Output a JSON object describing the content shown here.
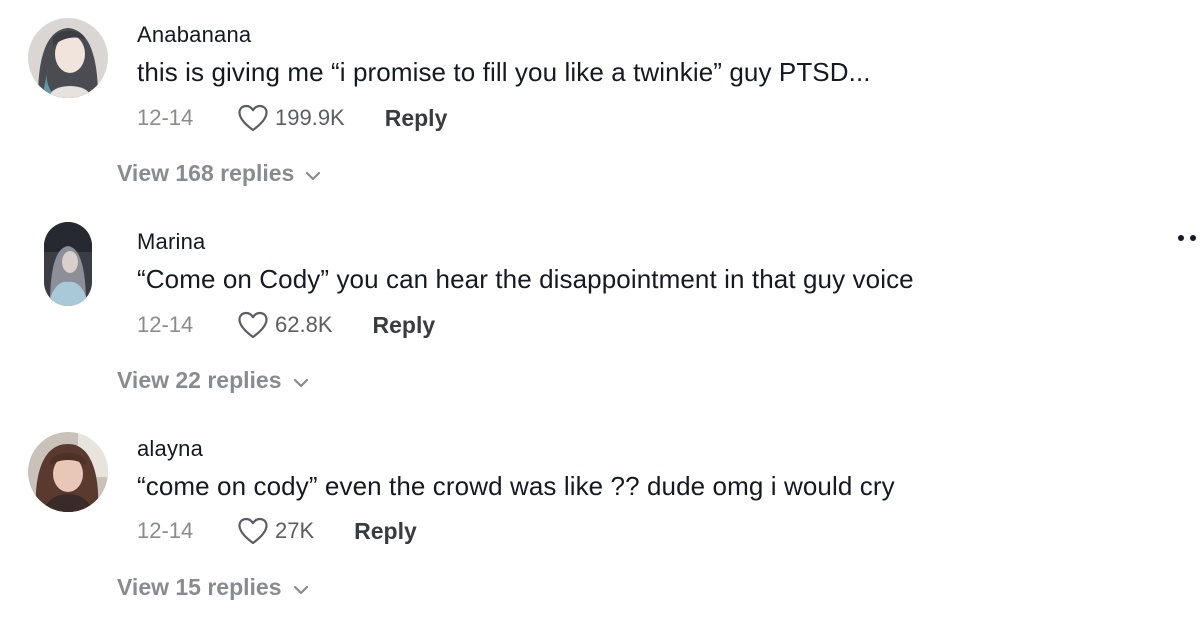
{
  "comments": [
    {
      "username": "Anabanana",
      "text": "this is giving me “i promise to fill you like a twinkie” guy PTSD...",
      "date": "12-14",
      "likes": "199.9K",
      "reply_label": "Reply",
      "view_replies": "View 168 replies"
    },
    {
      "username": "Marina",
      "text": "“Come on Cody” you can hear the disappointment in that guy voice",
      "date": "12-14",
      "likes": "62.8K",
      "reply_label": "Reply",
      "view_replies": "View 22 replies"
    },
    {
      "username": "alayna",
      "text": "“come on cody” even the crowd was like ?? dude omg i would cry",
      "date": "12-14",
      "likes": "27K",
      "reply_label": "Reply",
      "view_replies": "View 15 replies"
    }
  ],
  "icons": {
    "like": "heart-outline-icon",
    "expand": "chevron-down-icon",
    "more": "more-options-icon"
  },
  "colors": {
    "primary_text": "#161823",
    "secondary_text": "#8a8b91"
  }
}
